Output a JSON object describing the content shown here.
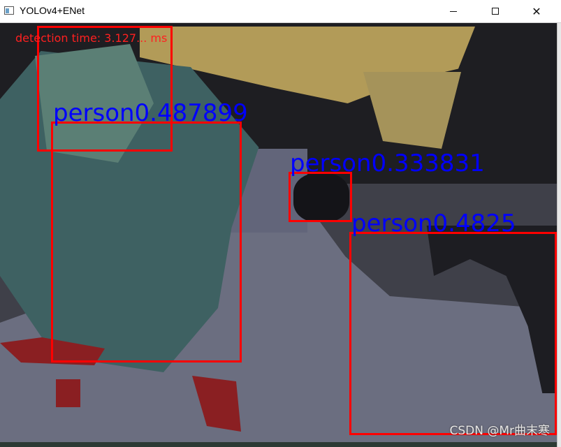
{
  "window": {
    "title": "YOLOv4+ENet",
    "icon": "window-app-icon",
    "controls": {
      "minimize": "minimize",
      "maximize": "maximize",
      "close": "✕"
    }
  },
  "overlay": {
    "detection_time": "detection time: 3.127... ms",
    "watermark": "CSDN @Mr曲末寒"
  },
  "detections": [
    {
      "label": "person0.487899"
    },
    {
      "label": "person0.333831"
    },
    {
      "label": "person0.4825"
    }
  ],
  "colors": {
    "box": "#ff0000",
    "label": "#0000ff",
    "timer": "#ff2020"
  }
}
